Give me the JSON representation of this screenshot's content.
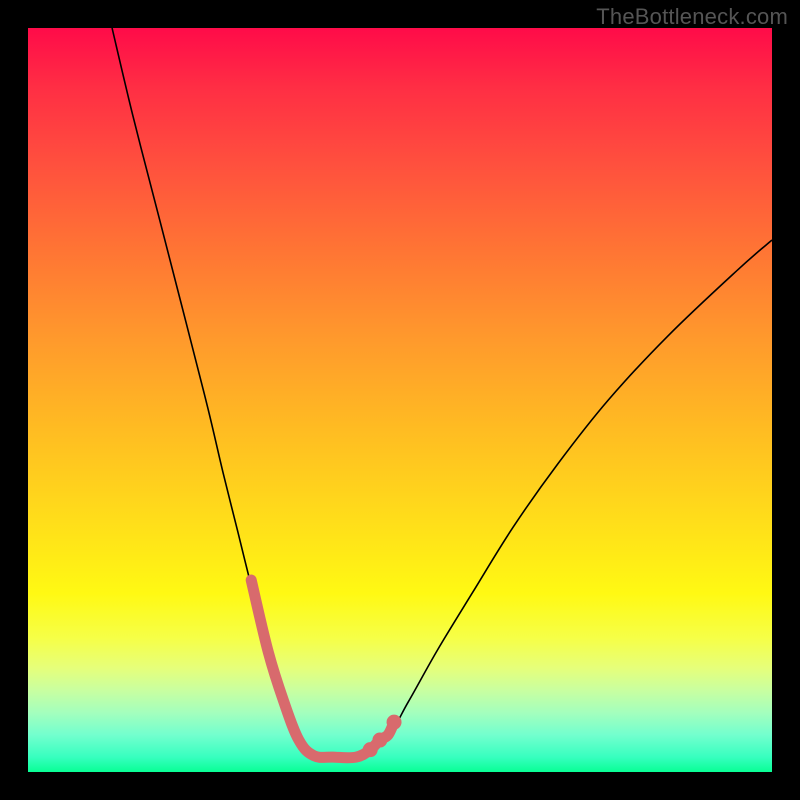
{
  "watermark": "TheBottleneck.com",
  "colors": {
    "background": "#000000",
    "curve": "#000000",
    "accent": "#d86a6d"
  },
  "chart_data": {
    "type": "line",
    "title": "",
    "xlabel": "",
    "ylabel": "",
    "xlim": [
      0,
      100
    ],
    "ylim": [
      0,
      100
    ],
    "grid": false,
    "legend": false,
    "note": "Axes are unlabeled in the image; x/y values are estimated from pixel positions (0–100 normalized).",
    "series": [
      {
        "name": "bottleneck-curve",
        "x": [
          11.3,
          14.1,
          17.7,
          21.3,
          24.2,
          26.2,
          28.2,
          30.2,
          32.3,
          34.4,
          36.4,
          38.4,
          44.1,
          48.4,
          51.1,
          55.1,
          59.8,
          65.2,
          71.2,
          78.0,
          86.0,
          95.4,
          100.0
        ],
        "y": [
          100.0,
          88.2,
          74.2,
          60.2,
          48.8,
          40.3,
          32.3,
          24.2,
          16.1,
          9.4,
          4.3,
          2.2,
          2.0,
          5.0,
          9.4,
          16.5,
          24.2,
          32.9,
          41.4,
          50.0,
          58.6,
          67.5,
          71.5
        ]
      }
    ],
    "highlight": {
      "name": "valley-accent",
      "x": [
        30.0,
        32.3,
        34.4,
        36.4,
        38.4,
        41.0,
        44.1,
        46.0,
        47.3,
        48.4,
        49.2
      ],
      "y": [
        25.8,
        16.1,
        9.4,
        4.3,
        2.2,
        2.0,
        2.0,
        3.0,
        4.3,
        5.0,
        6.7
      ]
    },
    "highlight_dots": {
      "x": [
        46.0,
        47.3,
        49.2
      ],
      "y": [
        3.0,
        4.3,
        6.7
      ]
    }
  }
}
